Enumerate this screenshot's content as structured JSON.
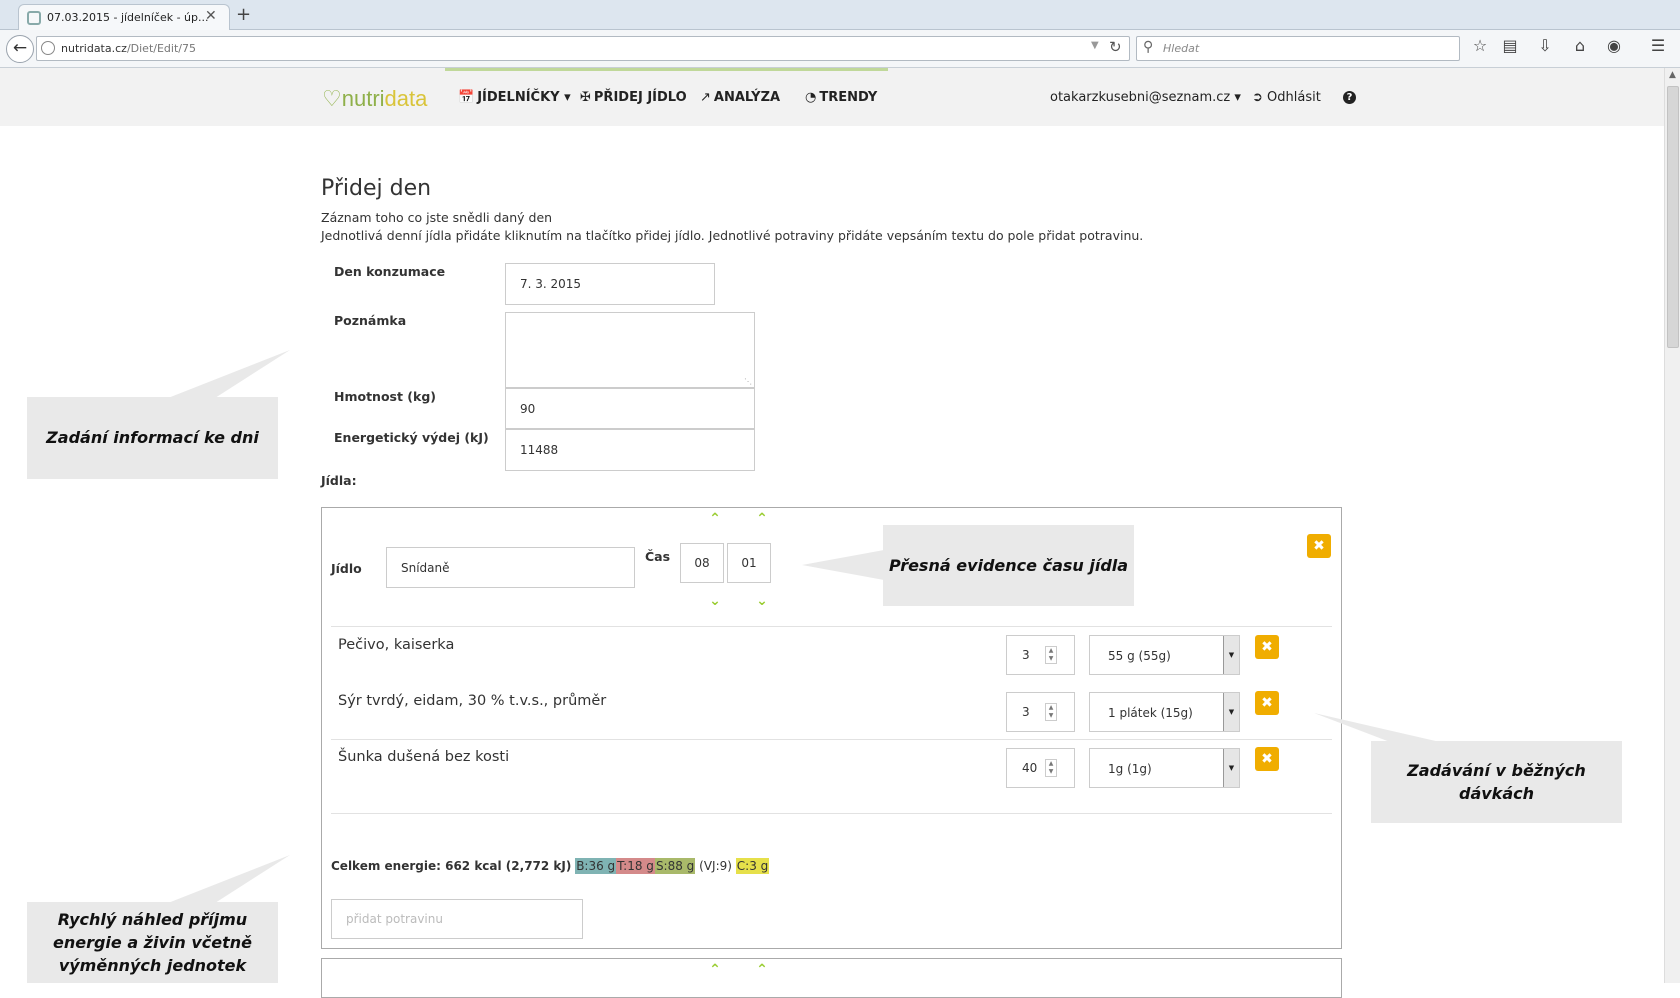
{
  "browser": {
    "tab_title": "07.03.2015 - jídelníček - úp...",
    "tab_close": "✕",
    "new_tab": "+",
    "url_host": "nutridata.cz",
    "url_path": "/Diet/Edit/75",
    "search_placeholder": "Hledat"
  },
  "site": {
    "logo_nutri": "nutri",
    "logo_data": "data",
    "nav": [
      {
        "label": "JÍDELNÍČKY"
      },
      {
        "label": "PŘIDEJ JÍDLO"
      },
      {
        "label": "ANALÝZA"
      },
      {
        "label": "TRENDY"
      }
    ],
    "user_email": "otakarzkusebni@seznam.cz",
    "logout": "Odhlásit",
    "help": "?"
  },
  "page": {
    "title": "Přidej den",
    "desc1": "Záznam toho co jste snědli daný den",
    "desc2": "Jednotlivá denní jídla přidáte kliknutím na tlačítko přidej jídlo. Jednotlivé potraviny přidáte vepsáním textu do pole přidat potravinu."
  },
  "form": {
    "date_label": "Den konzumace",
    "date_value": "7. 3. 2015",
    "note_label": "Poznámka",
    "weight_label": "Hmotnost (kg)",
    "weight_value": "90",
    "energy_label": "Energetický výdej (kJ)",
    "energy_value": "11488",
    "meals_label": "Jídla:"
  },
  "meal": {
    "meal_label": "Jídlo",
    "meal_value": "Snídaně",
    "time_label": "Čas",
    "hour": "08",
    "minute": "01",
    "remove": "✖",
    "foods": [
      {
        "name": "Pečivo, kaiserka",
        "qty": "3",
        "portion": "55 g (55g)"
      },
      {
        "name": "Sýr tvrdý, eidam, 30 % t.v.s., průměr",
        "qty": "3",
        "portion": "1 plátek (15g)"
      },
      {
        "name": "Šunka dušená bez kosti",
        "qty": "40",
        "portion": "1g (1g)"
      }
    ],
    "totals_label": "Celkem energie: 662 kcal (2,772 kJ)",
    "tag_b": "B:36 g",
    "tag_t": "T:18 g",
    "tag_s": "S:88 g",
    "vj": "(VJ:9)",
    "tag_c": "C:3 g",
    "add_food_placeholder": "přidat potravinu"
  },
  "callouts": {
    "day_info": "Zadání informací ke dni",
    "meal_time": "Přesná evidence času jídla",
    "portions": "Zadávání v běžných dávkách",
    "preview": "Rychlý náhled příjmu energie a živin včetně výměnných jednotek"
  },
  "colors": {
    "accent_orange": "#f0ad00",
    "chevron_green": "#9acd32",
    "tag_b": "#7fb3b3",
    "tag_t": "#d48a8a",
    "tag_s": "#a9b96a",
    "tag_c": "#e6e04a"
  }
}
